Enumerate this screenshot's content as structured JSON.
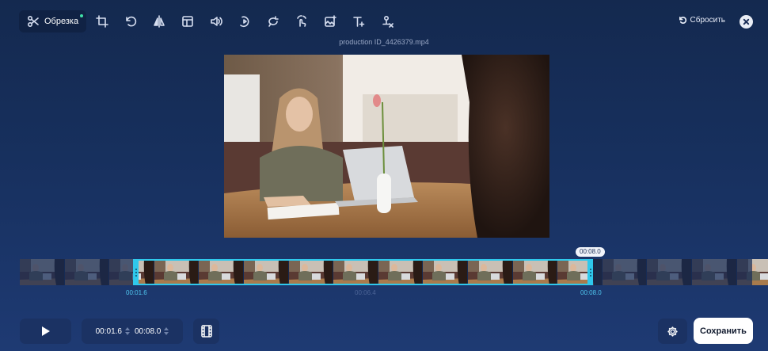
{
  "toolbar": {
    "active_tool_label": "Обрезка",
    "tools": [
      "crop-icon",
      "rotate-icon",
      "flip-icon",
      "layout-icon",
      "volume-icon",
      "speed-icon",
      "loop-icon",
      "stabilize-icon",
      "add-image-icon",
      "add-text-icon",
      "remove-watermark-icon"
    ]
  },
  "header": {
    "reset_label": "Сбросить"
  },
  "video": {
    "filename": "production ID_4426379.mp4"
  },
  "timeline": {
    "selection_start": "00:01.6",
    "selection_end": "00:08.0",
    "midpoint": "00:06.4",
    "playhead_bubble": "00:08.0",
    "frame_count": 17
  },
  "bottom_bar": {
    "start_time": "00:01.6",
    "end_time": "00:08.0",
    "save_label": "Сохранить"
  },
  "colors": {
    "accent": "#2fc8ec",
    "background": "#17305e",
    "badge_dot": "#3fe0a8"
  }
}
